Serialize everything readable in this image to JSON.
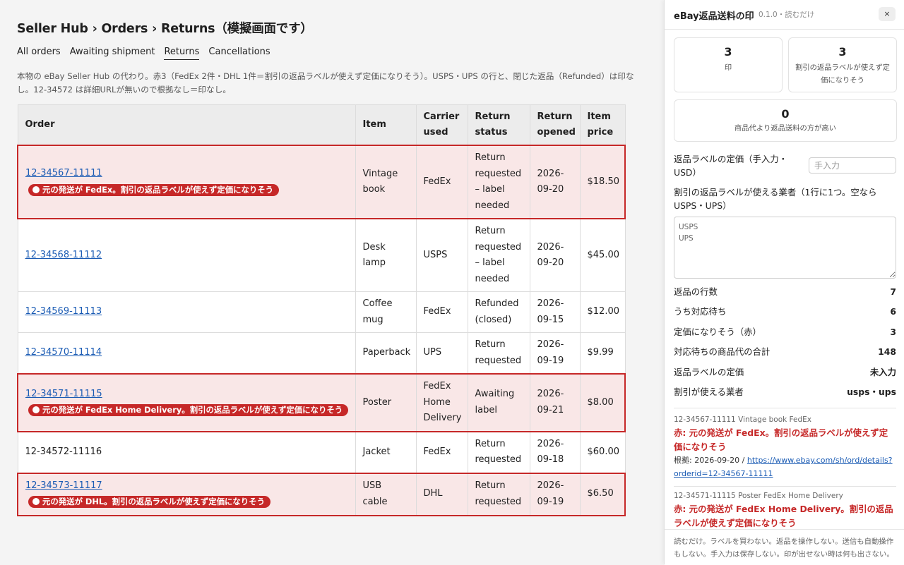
{
  "main": {
    "title": "Seller Hub › Orders › Returns（模擬画面です）",
    "tabs": [
      {
        "label": "All orders"
      },
      {
        "label": "Awaiting shipment"
      },
      {
        "label": "Returns"
      },
      {
        "label": "Cancellations"
      }
    ],
    "description": "本物の eBay Seller Hub の代わり。赤3（FedEx 2件・DHL 1件＝割引の返品ラベルが使えず定価になりそう）。USPS・UPS の行と、閉じた返品（Refunded）は印なし。12-34572 は詳細URLが無いので根拠なし＝印なし。",
    "columns": [
      "Order",
      "Item",
      "Carrier used",
      "Return status",
      "Return opened",
      "Item price"
    ],
    "rows": [
      {
        "order": "12-34567-11111",
        "badge": "元の発送が FedEx。割引の返品ラベルが使えず定価になりそう",
        "item": "Vintage book",
        "carrier": "FedEx",
        "status": "Return requested – label needed",
        "opened": "2026-09-20",
        "price": "$18.50"
      },
      {
        "order": "12-34568-11112",
        "badge": "",
        "item": "Desk lamp",
        "carrier": "USPS",
        "status": "Return requested – label needed",
        "opened": "2026-09-20",
        "price": "$45.00"
      },
      {
        "order": "12-34569-11113",
        "badge": "",
        "item": "Coffee mug",
        "carrier": "FedEx",
        "status": "Refunded (closed)",
        "opened": "2026-09-15",
        "price": "$12.00"
      },
      {
        "order": "12-34570-11114",
        "badge": "",
        "item": "Paperback",
        "carrier": "UPS",
        "status": "Return requested",
        "opened": "2026-09-19",
        "price": "$9.99"
      },
      {
        "order": "12-34571-11115",
        "badge": "元の発送が FedEx Home Delivery。割引の返品ラベルが使えず定価になりそう",
        "item": "Poster",
        "carrier": "FedEx Home Delivery",
        "status": "Awaiting label",
        "opened": "2026-09-21",
        "price": "$8.00"
      },
      {
        "order": "12-34572-11116",
        "badge": "",
        "item": "Jacket",
        "carrier": "FedEx",
        "status": "Return requested",
        "opened": "2026-09-18",
        "price": "$60.00"
      },
      {
        "order": "12-34573-11117",
        "badge": "元の発送が DHL。割引の返品ラベルが使えず定価になりそう",
        "item": "USB cable",
        "carrier": "DHL",
        "status": "Return requested",
        "opened": "2026-09-19",
        "price": "$6.50"
      }
    ]
  },
  "panel": {
    "title": "eBay返品送料の印",
    "version": "0.1.0・読むだけ",
    "close_label": "×",
    "stats": [
      {
        "value": "3",
        "label": "印"
      },
      {
        "value": "3",
        "label": "割引の返品ラベルが使えず定価になりそう"
      },
      {
        "value": "0",
        "label": "商品代より返品送料の方が高い"
      }
    ],
    "price_label": "返品ラベルの定価（手入力・USD）",
    "price_placeholder": "手入力",
    "carriers_label": "割引の返品ラベルが使える業者（1行に1つ。空なら USPS・UPS）",
    "carriers_placeholder": "USPS\nUPS",
    "summary": [
      {
        "label": "返品の行数",
        "value": "7"
      },
      {
        "label": "うち対応待ち",
        "value": "6"
      },
      {
        "label": "定価になりそう（赤）",
        "value": "3"
      },
      {
        "label": "対応待ちの商品代の合計",
        "value": "148"
      },
      {
        "label": "返品ラベルの定価",
        "value": "未入力"
      },
      {
        "label": "割引が使える業者",
        "value": "usps・ups"
      }
    ],
    "findings": [
      {
        "meta": "12-34567-11111 Vintage book FedEx",
        "text": "赤: 元の発送が FedEx。割引の返品ラベルが使えず定価になりそう",
        "basis_prefix": "根拠: 2026-09-20 / ",
        "url": "https://www.ebay.com/sh/ord/details?orderid=12-34567-11111"
      },
      {
        "meta": "12-34571-11115 Poster FedEx Home Delivery",
        "text": "赤: 元の発送が FedEx Home Delivery。割引の返品ラベルが使えず定価になりそう"
      }
    ],
    "footer": "読むだけ。ラベルを買わない。返品を操作しない。送信も自動操作もしない。手入力は保存しない。印が出せない時は何も出さない。"
  },
  "colors": {
    "flag_red": "#c62828",
    "flag_bg": "#f9e7e7",
    "link_blue": "#1a5bb4"
  }
}
